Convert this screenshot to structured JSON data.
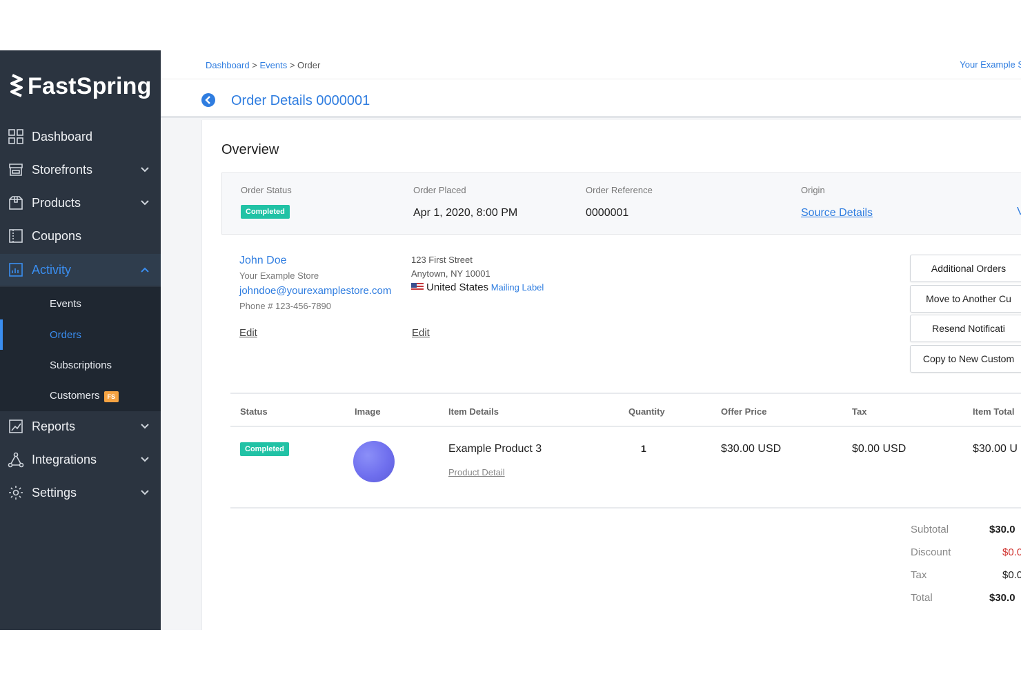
{
  "sidebar": {
    "brand": "FastSpring",
    "items": [
      {
        "label": "Dashboard",
        "icon": "grid-icon"
      },
      {
        "label": "Storefronts",
        "icon": "storefront-icon"
      },
      {
        "label": "Products",
        "icon": "box-icon"
      },
      {
        "label": "Coupons",
        "icon": "coupon-icon"
      },
      {
        "label": "Activity",
        "icon": "activity-icon"
      },
      {
        "label": "Reports",
        "icon": "reports-icon"
      },
      {
        "label": "Integrations",
        "icon": "integrations-icon"
      },
      {
        "label": "Settings",
        "icon": "gear-icon"
      }
    ],
    "activity_sub": [
      {
        "label": "Events"
      },
      {
        "label": "Orders"
      },
      {
        "label": "Subscriptions"
      },
      {
        "label": "Customers",
        "badge": "FS"
      }
    ],
    "colors": {
      "background": "#2b3440",
      "accent": "#3a8ef0"
    }
  },
  "breadcrumb": {
    "dashboard": "Dashboard",
    "events": "Events",
    "order": "Order",
    "sep": ">"
  },
  "store_link": "Your Example S",
  "page_title": "Order Details 0000001",
  "overview": {
    "title": "Overview",
    "status_label": "Order Status",
    "status_value": "Completed",
    "placed_label": "Order Placed",
    "placed_value": "Apr 1, 2020, 8:00 PM",
    "reference_label": "Order Reference",
    "reference_value": "0000001",
    "origin_label": "Origin",
    "origin_value": "Source Details",
    "edge_text": "V"
  },
  "customer": {
    "name": "John Doe",
    "store": "Your Example Store",
    "email": "johndoe@yourexamplestore.com",
    "phone": "Phone # 123-456-7890",
    "edit": "Edit"
  },
  "address": {
    "line1": "123 First Street",
    "line2": "Anytown, NY 10001",
    "country": "United States",
    "mailing_label": "Mailing Label",
    "edit": "Edit"
  },
  "actions": [
    {
      "label": "Additional Orders"
    },
    {
      "label": "Move to Another Cu"
    },
    {
      "label": "Resend Notificati"
    },
    {
      "label": "Copy to New Custom"
    }
  ],
  "items_table": {
    "headers": [
      "Status",
      "Image",
      "Item Details",
      "Quantity",
      "Offer Price",
      "Tax",
      "Item Total"
    ],
    "rows": [
      {
        "status": "Completed",
        "item": "Example Product 3",
        "detail_link": "Product Detail",
        "quantity": "1",
        "offer_price": "$30.00 USD",
        "tax": "$0.00 USD",
        "total": "$30.00 U"
      }
    ]
  },
  "totals": {
    "subtotal_label": "Subtotal",
    "subtotal_value": "$30.0",
    "discount_label": "Discount",
    "discount_value": "$0.0",
    "tax_label": "Tax",
    "tax_value": "$0.0",
    "total_label": "Total",
    "total_value": "$30.0",
    "discount_color": "#d0312d"
  },
  "colors": {
    "link": "#2f7de0",
    "status_badge": "#21c2a5",
    "badge_fs": "#f5a342"
  }
}
